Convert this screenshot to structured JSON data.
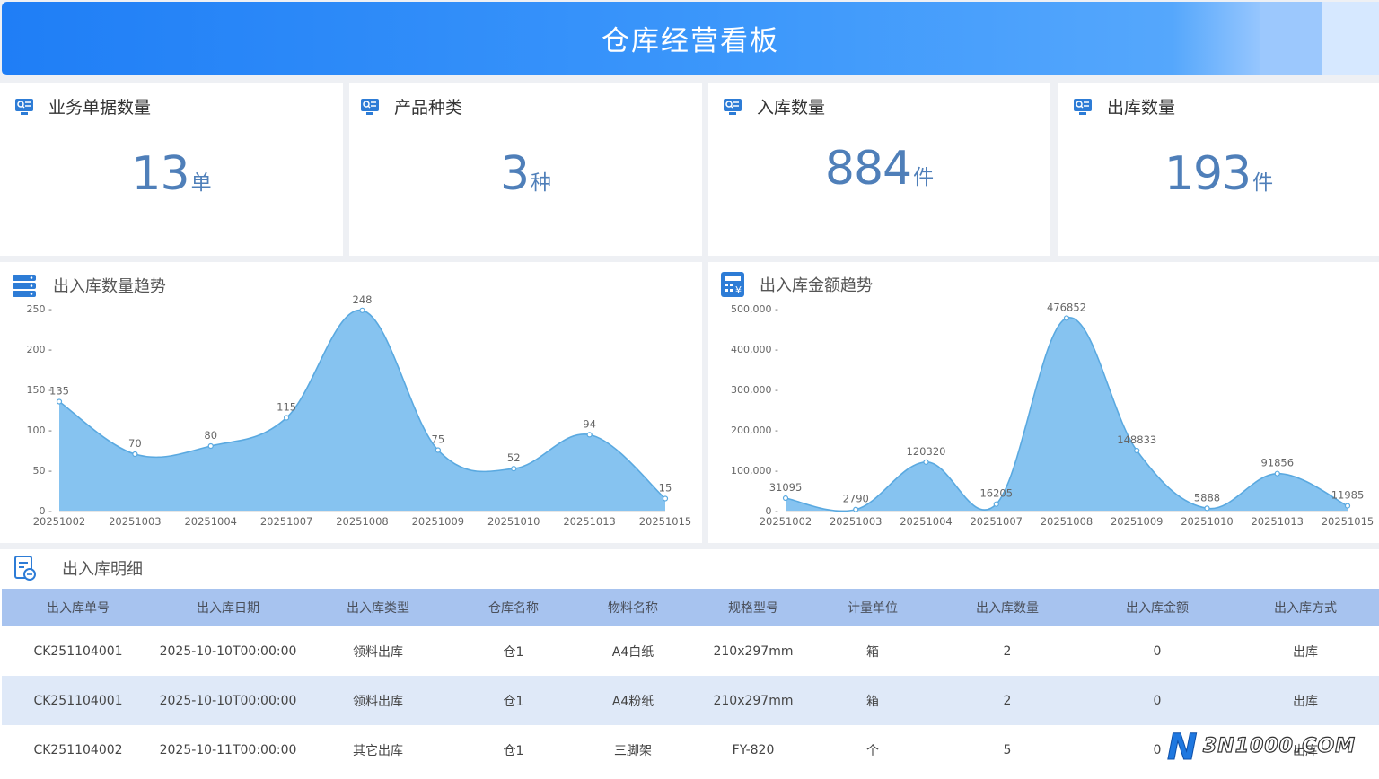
{
  "header": {
    "title": "仓库经营看板"
  },
  "kpis": [
    {
      "label": "业务单据数量",
      "value": "13",
      "unit": "单"
    },
    {
      "label": "产品种类",
      "value": "3",
      "unit": "种"
    },
    {
      "label": "入库数量",
      "value": "884",
      "unit": "件"
    },
    {
      "label": "出库数量",
      "value": "193",
      "unit": "件"
    }
  ],
  "quantity_chart": {
    "title": "出入库数量趋势"
  },
  "amount_chart": {
    "title": "出入库金额趋势"
  },
  "chart_data": [
    {
      "type": "area",
      "title": "出入库数量趋势",
      "categories": [
        "20251002",
        "20251003",
        "20251004",
        "20251007",
        "20251008",
        "20251009",
        "20251010",
        "20251013",
        "20251015"
      ],
      "values": [
        135,
        70,
        80,
        115,
        248,
        75,
        52,
        94,
        15
      ],
      "yticks": [
        "0",
        "50",
        "100",
        "150",
        "200",
        "250"
      ],
      "ylim": [
        0,
        250
      ],
      "color": "#86c3f0",
      "line_color": "#5aa9e0"
    },
    {
      "type": "area",
      "title": "出入库金额趋势",
      "categories": [
        "20251002",
        "20251003",
        "20251004",
        "20251007",
        "20251008",
        "20251009",
        "20251010",
        "20251013",
        "20251015"
      ],
      "values": [
        31095,
        2790,
        120320,
        16205,
        476852,
        148833,
        5888,
        91856,
        11985
      ],
      "yticks": [
        "0",
        "100,000",
        "200,000",
        "300,000",
        "400,000",
        "500,000"
      ],
      "ylim": [
        0,
        500000
      ],
      "color": "#86c3f0",
      "line_color": "#5aa9e0"
    }
  ],
  "detail": {
    "title": "出入库明细",
    "columns": [
      "出入库单号",
      "出入库日期",
      "出入库类型",
      "仓库名称",
      "物料名称",
      "规格型号",
      "计量单位",
      "出入库数量",
      "出入库金额",
      "出入库方式"
    ],
    "rows": [
      [
        "CK251104001",
        "2025-10-10T00:00:00",
        "领料出库",
        "仓1",
        "A4白纸",
        "210x297mm",
        "箱",
        "2",
        "0",
        "出库"
      ],
      [
        "CK251104001",
        "2025-10-10T00:00:00",
        "领料出库",
        "仓1",
        "A4粉纸",
        "210x297mm",
        "箱",
        "2",
        "0",
        "出库"
      ],
      [
        "CK251104002",
        "2025-10-11T00:00:00",
        "其它出库",
        "仓1",
        "三脚架",
        "FY-820",
        "个",
        "5",
        "0",
        "出库"
      ]
    ]
  },
  "watermark": {
    "text": "3N1000.COM",
    "letter": "N"
  },
  "colors": {
    "accent": "#2f8cf8",
    "kpi": "#4f7fb9",
    "table_header": "#a7c3ef",
    "row_alt": "#dfe9f8"
  }
}
